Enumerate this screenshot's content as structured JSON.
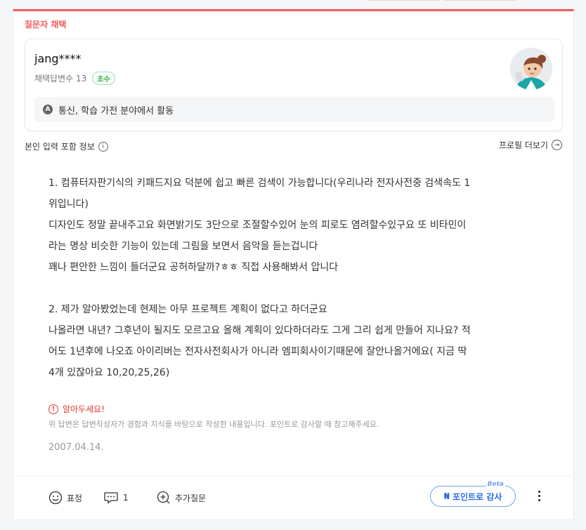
{
  "section_label": "질문자 채택",
  "profile": {
    "username": "jang****",
    "adopted_count_text": "채택답변수 13",
    "level_badge": "초수",
    "field": "통신, 학습 가전 분야에서 활동",
    "field_icon": "a-circle-icon"
  },
  "info": {
    "left_label": "본인 입력 포함 정보",
    "right_label": "프로필 더보기"
  },
  "answer": {
    "lines": [
      "1. 컴퓨터자판기식의 키패드지요 덕분에 쉽고 빠른 검색이 가능합니다(우리나라 전자사전중 검색속도 1",
      "위입니다)",
      "디자인도 정말 끝내주고요 화면밝기도 3단으로 조절할수있어 눈의 피로도 염려할수있구요 또 비타민이",
      "라는 명상 비슷한 기능이 있는데 그림을 보면서 음악을 듣는겁니다",
      "꽤나 편안한 느낌이 들더군요 공허하달까?ㅎㅎ 직접 사용해봐서 압니다",
      "",
      "2. 제가 알아봤었는데 현제는 아무 프로젝트 계획이 없다고 하더군요",
      "나올라면 내년? 그후년이 될지도 모르고요 올해 계획이 있다하더라도 그게 그리 쉽게 만들어 지나요? 적",
      "어도 1년후에 나오죠 아이리버는 전자사전회사가 아니라 엠피회사이기때문에 잘안나올거에요( 지금 딱",
      "4개 있잖아요 10,20,25,26)"
    ]
  },
  "notice": {
    "title": "알아두세요!",
    "desc": "위 답변은 답변작성자가 경험과 지식을 바탕으로 작성한 내용입니다. 포인트로 감사할 때 참고해주세요."
  },
  "date": "2007.04.14.",
  "actions": {
    "reaction_label": "표정",
    "comment_count": "1",
    "followup_label": "추가질문",
    "point_label": "포인트로 감사",
    "point_badge": "Beta"
  },
  "colors": {
    "accent_red": "#f45b5b",
    "accent_blue": "#2c6ee0",
    "badge_green": "#3db351"
  }
}
